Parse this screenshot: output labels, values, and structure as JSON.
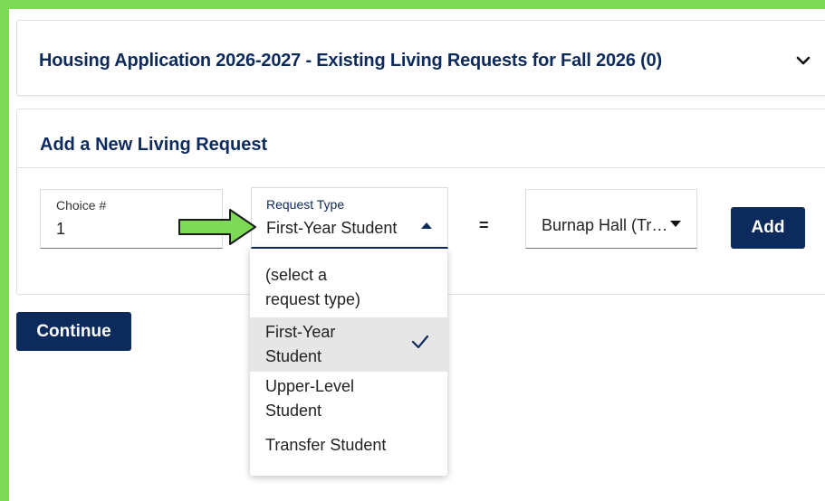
{
  "existing_requests": {
    "title": "Housing Application 2026-2027 - Existing Living Requests for Fall 2026 (0)",
    "toggle_icon": "chevron-down-icon"
  },
  "new_request": {
    "heading": "Add a New Living Request",
    "choice": {
      "label": "Choice #",
      "value": "1"
    },
    "request_type": {
      "label": "Request Type",
      "value": "First-Year Student",
      "options": [
        {
          "label": "(select a request type)",
          "selected": false
        },
        {
          "label": "First-Year Student",
          "selected": true
        },
        {
          "label": "Upper-Level Student",
          "selected": false
        },
        {
          "label": "Transfer Student",
          "selected": false
        }
      ]
    },
    "operator": "=",
    "hall": {
      "value": "Burnap Hall (Tr…"
    },
    "add_label": "Add"
  },
  "continue_label": "Continue",
  "colors": {
    "accent": "#0d2a5c",
    "frame": "#7ed957",
    "arrow": "#7ed957",
    "selected_bg": "#e6e6e6"
  }
}
